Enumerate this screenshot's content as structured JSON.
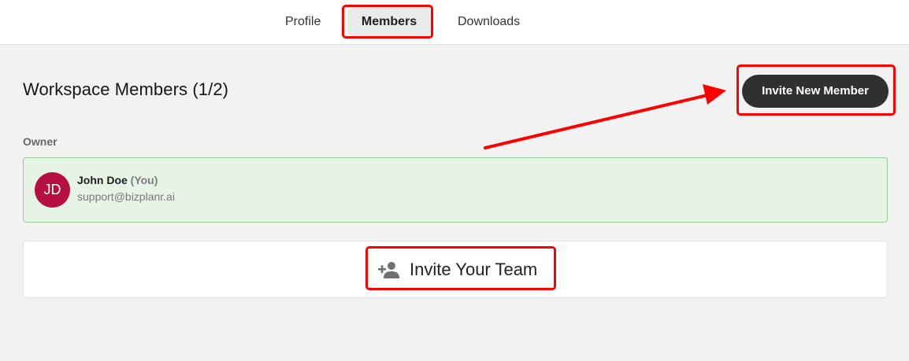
{
  "tabs": [
    {
      "label": "Profile"
    },
    {
      "label": "Members",
      "active": true
    },
    {
      "label": "Downloads"
    }
  ],
  "header": {
    "title": "Workspace Members (1/2)",
    "invite_button_label": "Invite New Member"
  },
  "owner_section": {
    "label": "Owner",
    "member": {
      "initials": "JD",
      "name": "John Doe",
      "you_tag": "(You)",
      "email": "support@bizplanr.ai",
      "avatar_color": "#b5103f"
    }
  },
  "invite_team": {
    "label": "Invite Your Team",
    "icon": "person-add-icon"
  },
  "colors": {
    "highlight": "#ff0000",
    "page_bg": "#f1f2f1",
    "button_dark": "#2f302f",
    "owner_card_bg": "#e6f4e6",
    "owner_card_border": "#97cc97"
  }
}
